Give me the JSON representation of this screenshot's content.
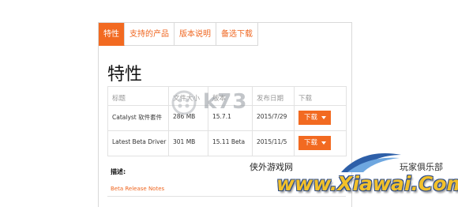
{
  "tabs": [
    {
      "label": "特性",
      "active": true
    },
    {
      "label": "支持的产品",
      "active": false
    },
    {
      "label": "版本说明",
      "active": false
    },
    {
      "label": "备选下载",
      "active": false
    }
  ],
  "heading": "特性",
  "table": {
    "headers": [
      "标题",
      "文件大小",
      "版本",
      "发布日期",
      "下载"
    ],
    "rows": [
      {
        "title": "Catalyst 软件套件",
        "size": "286 MB",
        "version": "15.7.1",
        "date": "2015/7/29",
        "download": "下载"
      },
      {
        "title": "Latest Beta Driver",
        "size": "301 MB",
        "version": "15.11 Beta",
        "date": "2015/11/5",
        "download": "下载"
      }
    ]
  },
  "description": {
    "label": "描述:",
    "link": "Beta Release Notes"
  },
  "watermark": {
    "center": "k73",
    "site_cn": "侠外游戏网",
    "site_en": "www.Xiawai.Com",
    "tagline": "玩家俱乐部"
  },
  "colors": {
    "accent": "#f26a21",
    "border": "#d9d9d9"
  }
}
